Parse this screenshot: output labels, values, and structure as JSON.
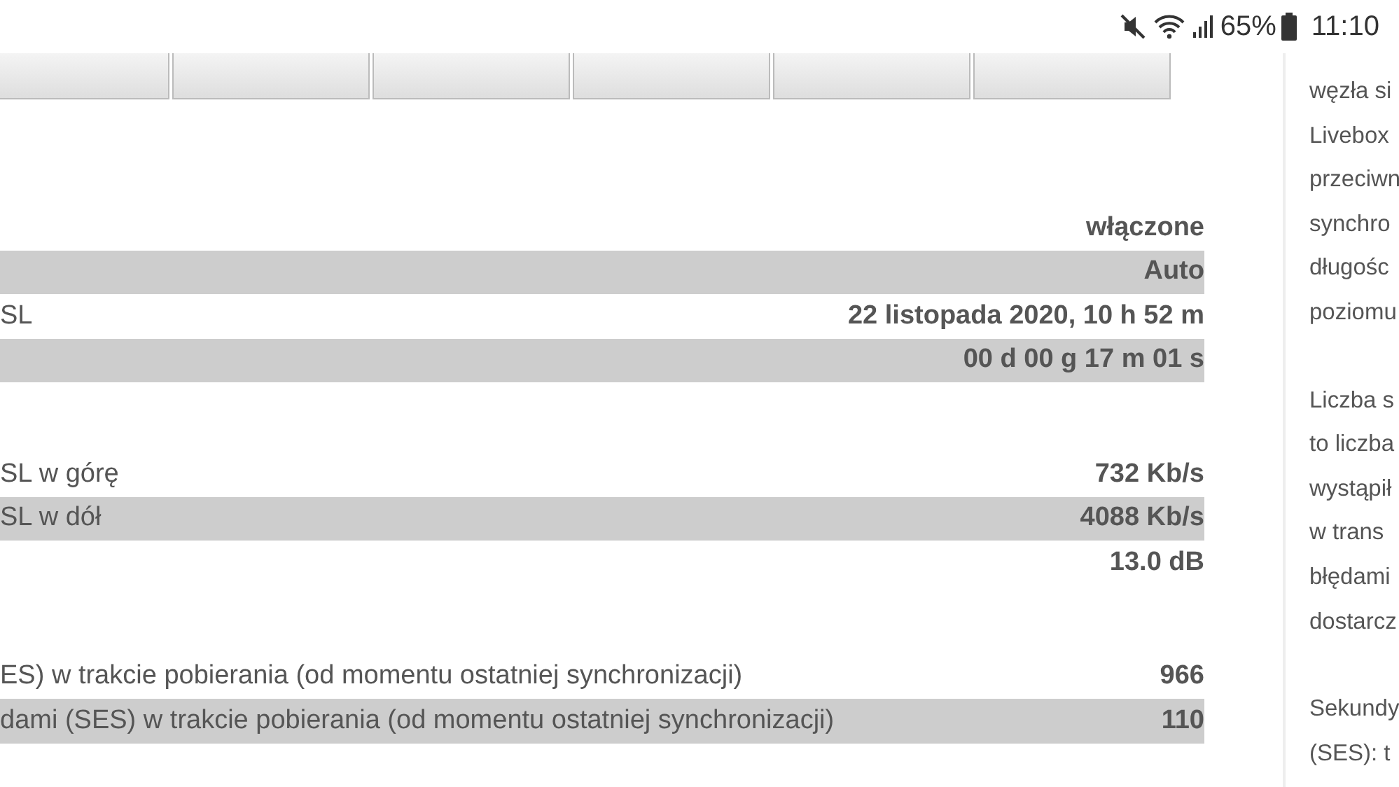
{
  "status_bar": {
    "battery": "65%",
    "time": "11:10"
  },
  "tabs": [
    {
      "selected": false
    },
    {
      "selected": false
    },
    {
      "selected": false
    },
    {
      "selected": false
    },
    {
      "selected": false
    },
    {
      "selected": false
    }
  ],
  "sections": [
    {
      "rows": [
        {
          "label": "",
          "value": "włączone",
          "shaded": false
        },
        {
          "label": "",
          "value": "Auto",
          "shaded": true
        },
        {
          "label": "SL",
          "value": "22 listopada 2020, 10 h 52 m",
          "shaded": false
        },
        {
          "label": "",
          "value": "00 d 00 g 17 m 01 s",
          "shaded": true
        }
      ]
    },
    {
      "rows": [
        {
          "label": "SL w górę",
          "value": "732 Kb/s",
          "shaded": false
        },
        {
          "label": "SL w dół",
          "value": "4088 Kb/s",
          "shaded": true
        },
        {
          "label": "",
          "value": "13.0 dB",
          "shaded": false
        }
      ]
    },
    {
      "rows": [
        {
          "label": "ES) w trakcie pobierania (od momentu ostatniej synchronizacji)",
          "value": "966",
          "shaded": false
        },
        {
          "label": "dami (SES) w trakcie pobierania (od momentu ostatniej synchronizacji)",
          "value": "110",
          "shaded": true
        }
      ]
    }
  ],
  "side_panel": {
    "paragraphs": [
      [
        "węzła si",
        "Livebox",
        "przeciwn",
        "synchro",
        "długośc",
        "poziomu"
      ],
      [
        "Liczba s",
        "to liczba",
        "wystąpił",
        "w trans",
        "błędami",
        "dostarcz"
      ],
      [
        "Sekundy",
        "(SES): t"
      ]
    ]
  }
}
